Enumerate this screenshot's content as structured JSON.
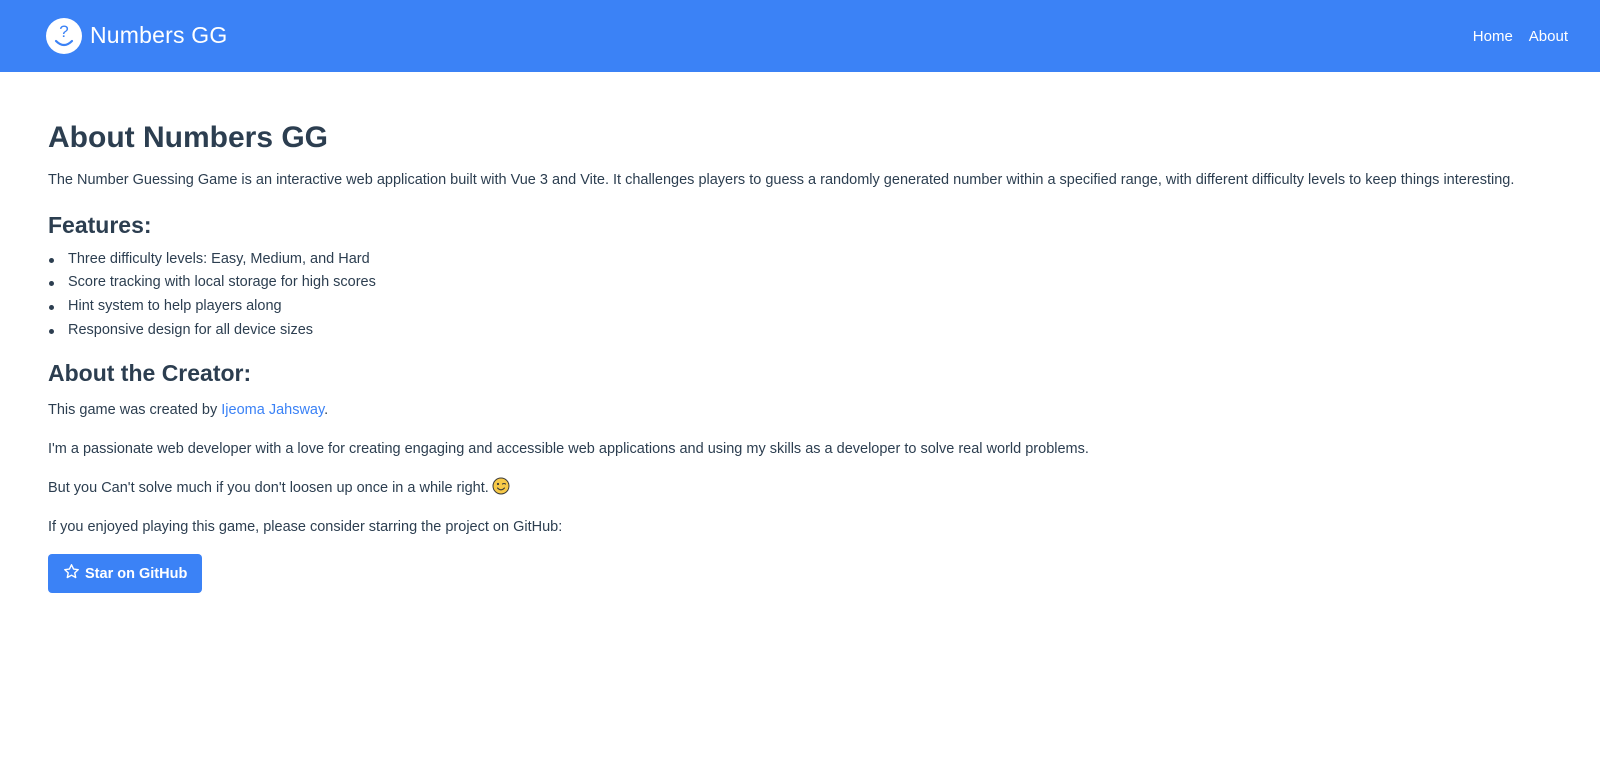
{
  "navbar": {
    "brand": "Numbers GG",
    "logo_icon": "question-face-icon",
    "links": [
      "Home",
      "About"
    ]
  },
  "about": {
    "title": "About Numbers GG",
    "intro": "The Number Guessing Game is an interactive web application built with Vue 3 and Vite. It challenges players to guess a randomly generated number within a specified range, with different difficulty levels to keep things interesting.",
    "features_heading": "Features:",
    "features": [
      "Three difficulty levels: Easy, Medium, and Hard",
      "Score tracking with local storage for high scores",
      "Hint system to help players along",
      "Responsive design for all device sizes"
    ],
    "creator_heading": "About the Creator:",
    "creator_prefix": "This game was created by ",
    "creator_name": "Ijeoma Jahsway",
    "creator_suffix": ".",
    "bio": "I'm a passionate web developer with a love for creating engaging and accessible web applications and using my skills as a developer to solve real world problems.",
    "joke": "But you Can't solve much if you don't loosen up once in a while right.",
    "joke_emoji_icon": "winking-face-icon",
    "github_prompt": "If you enjoyed playing this game, please consider starring the project on GitHub:",
    "github_button": "Star on GitHub",
    "github_button_icon": "star-icon"
  },
  "colors": {
    "primary": "#3b82f6",
    "text": "#2c3e50",
    "background": "#ffffff"
  }
}
